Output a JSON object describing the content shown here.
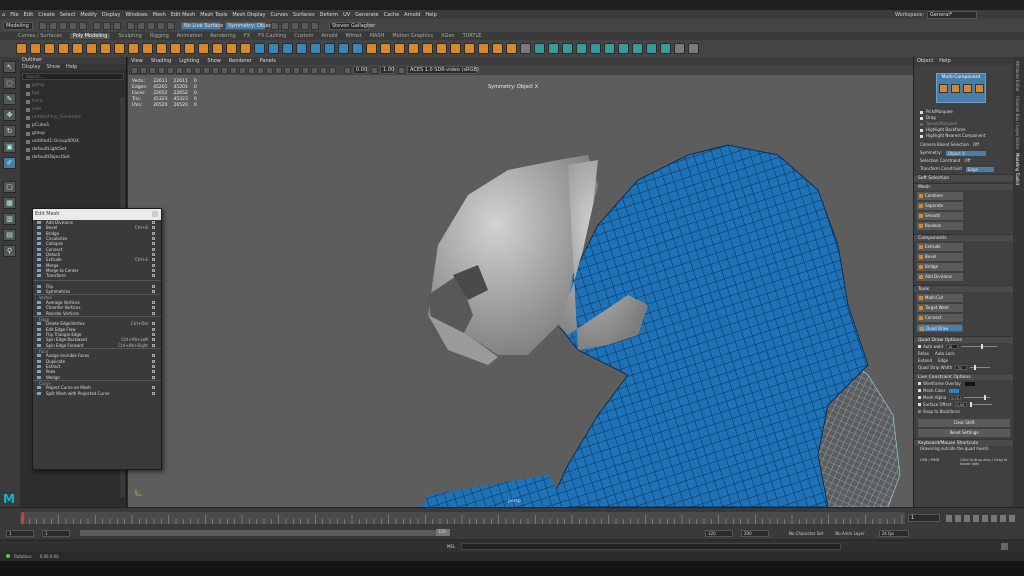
{
  "menubar": {
    "items": [
      "File",
      "Edit",
      "Create",
      "Select",
      "Modify",
      "Display",
      "Windows",
      "Mesh",
      "Edit Mesh",
      "Mesh Tools",
      "Mesh Display",
      "Curves",
      "Surfaces",
      "Deform",
      "UV",
      "Generate",
      "Cache",
      "Arnold",
      "Help"
    ],
    "workspace_label": "Workspace:",
    "workspace_value": "General*"
  },
  "shelfbar": {
    "mode": "Modeling",
    "no_live": "No Live Surface",
    "symmetry": "Symmetry: Object X",
    "user": "Steven Gallagher"
  },
  "shelf_tabs": [
    "Curves / Surfaces",
    "Poly Modeling",
    "Sculpting",
    "Rigging",
    "Animation",
    "Rendering",
    "FX",
    "FX Caching",
    "Custom",
    "Arnold",
    "Bifrost",
    "MASH",
    "Motion Graphics",
    "XGen",
    "TURTLE"
  ],
  "shelf_active": "Poly Modeling",
  "outliner": {
    "title": "Outliner",
    "menu": [
      "Display",
      "Show",
      "Help"
    ],
    "search": "Search...",
    "items": [
      {
        "label": "persp",
        "dim": true
      },
      {
        "label": "top",
        "dim": true
      },
      {
        "label": "front",
        "dim": true
      },
      {
        "label": "side",
        "dim": true
      },
      {
        "label": "untitled:Ivy_Generate",
        "dim": true
      },
      {
        "label": "pCube1",
        "dim": false
      },
      {
        "label": "group",
        "dim": false
      },
      {
        "label": "untitled1:Group0004",
        "dim": false
      },
      {
        "label": "defaultLightSet",
        "dim": false
      },
      {
        "label": "defaultObjectSet",
        "dim": false
      }
    ]
  },
  "viewport": {
    "menu": [
      "View",
      "Shading",
      "Lighting",
      "Show",
      "Renderer",
      "Panels"
    ],
    "gamma": "0.00",
    "exposure": "1.00",
    "colorspace": "ACES 1.0 SDR-video (sRGB)",
    "symmetry": "Symmetry: Object X",
    "camera": "persp",
    "hud": [
      {
        "k": "Verts:",
        "a": "22611",
        "b": "22611",
        "c": "0"
      },
      {
        "k": "Edges:",
        "a": "45201",
        "b": "45201",
        "c": "0"
      },
      {
        "k": "Faces:",
        "a": "22652",
        "b": "22652",
        "c": "0"
      },
      {
        "k": "Tris:",
        "a": "45323",
        "b": "45323",
        "c": "0"
      },
      {
        "k": "UVs:",
        "a": "26520",
        "b": "26520",
        "c": "0"
      }
    ]
  },
  "edit_mesh": {
    "title": "Edit Mesh",
    "groups": [
      {
        "section": "",
        "items": [
          {
            "l": "Add Divisions",
            "s": ""
          },
          {
            "l": "Bevel",
            "s": "Ctrl+B"
          },
          {
            "l": "Bridge",
            "s": ""
          },
          {
            "l": "Circularize",
            "s": ""
          },
          {
            "l": "Collapse",
            "s": ""
          },
          {
            "l": "Connect",
            "s": ""
          },
          {
            "l": "Detach",
            "s": ""
          },
          {
            "l": "Extrude",
            "s": "Ctrl+E"
          },
          {
            "l": "Merge",
            "s": ""
          },
          {
            "l": "Merge to Center",
            "s": ""
          },
          {
            "l": "Transform",
            "s": ""
          }
        ]
      },
      {
        "section": "",
        "items": [
          {
            "l": "Flip",
            "s": ""
          },
          {
            "l": "Symmetrize",
            "s": ""
          }
        ]
      },
      {
        "section": "Vertex",
        "items": [
          {
            "l": "Average Vertices",
            "s": ""
          },
          {
            "l": "Chamfer Vertices",
            "s": ""
          },
          {
            "l": "Reorder Vertices",
            "s": ""
          }
        ]
      },
      {
        "section": "Edge",
        "items": [
          {
            "l": "Delete Edge/Vertex",
            "s": "Ctrl+Del"
          },
          {
            "l": "Edit Edge Flow",
            "s": ""
          },
          {
            "l": "Flip Triangle Edge",
            "s": ""
          },
          {
            "l": "Spin Edge Backward",
            "s": "Ctrl+Alt+Left"
          },
          {
            "l": "Spin Edge Forward",
            "s": "Ctrl+Alt+Right"
          }
        ]
      },
      {
        "section": "Face",
        "items": [
          {
            "l": "Assign Invisible Faces",
            "s": ""
          },
          {
            "l": "Duplicate",
            "s": ""
          },
          {
            "l": "Extract",
            "s": ""
          },
          {
            "l": "Poke",
            "s": ""
          },
          {
            "l": "Wedge",
            "s": ""
          }
        ]
      },
      {
        "section": "Curve",
        "items": [
          {
            "l": "Project Curve on Mesh",
            "s": ""
          },
          {
            "l": "Split Mesh with Projected Curve",
            "s": ""
          }
        ]
      }
    ]
  },
  "right_panel": {
    "menu": [
      "Object",
      "Help"
    ],
    "multi_component": "Multi-Component",
    "pick_marquee": "Pick/Marquee",
    "drag": "Drag",
    "tweak_marquee": "Tweak/Marquee",
    "highlight_backfaces": "Highlight Backfaces",
    "highlight_nearest": "Highlight Nearest Component",
    "camera_based_selection": "Camera Based Selection",
    "camera_based_value": "Off",
    "symmetry_label": "Symmetry:",
    "symmetry_value": "Object X",
    "selection_constraint": "Selection Constraint",
    "selection_constraint_value": "Off",
    "transform_constraint": "Transform Constraint",
    "transform_constraint_value": "Edge",
    "soft_selection": "Soft Selection",
    "sections": {
      "mesh": "Mesh",
      "components": "Components",
      "tools": "Tools",
      "quad_draw": "Quad Draw Options",
      "live": "Live Constraint Options",
      "keyboard": "Keyboard/Mouse Shortcuts"
    },
    "mesh_btns": [
      "Combine",
      "Separate",
      "Smooth",
      "Boolean"
    ],
    "comp_btns": [
      "Extrude",
      "Bevel",
      "Bridge",
      "Add Divisions"
    ],
    "tool_btns": [
      "Multi-Cut",
      "Target Weld",
      "Connect",
      "Quad Draw"
    ],
    "auto_weld": "Auto weld",
    "auto_weld_value": "10",
    "relax": "Relax",
    "relax_value": "Auto Lock",
    "extend": "Extend",
    "extend_value": "Edge",
    "quad_strip": "Quad Strip Width",
    "quad_strip_value": "70",
    "wireframe_overlay": "Wireframe Overlay",
    "mesh_color": "Mesh Color",
    "mesh_alpha": "Mesh Alpha",
    "mesh_alpha_value": "0.75",
    "surface_offset": "Surface Offset",
    "surface_offset_value": "0.00",
    "snap_backfaces": "Snap to Backfaces",
    "clear_shift": "Clear Shift",
    "reset_settings": "Reset Settings",
    "shortcut_note": "(Hovering outside the quad mesh)",
    "lmb_label": "LMB / MMB",
    "lmb_desc": "Click to drop dots / Drag to tweak dots",
    "mesh_color_hex": "#1e88d0"
  },
  "side_tabs": [
    "Attribute Editor",
    "Channel Box / Layer Editor",
    "Modeling Toolkit"
  ],
  "timeline": {
    "current_frame": "1",
    "range_start": "1",
    "range_start2": "1",
    "range_current": "120",
    "range_end": "120",
    "range_end2": "200",
    "char_set": "No Character Set",
    "anim_layer": "No Anim Layer",
    "fps": "24 fps",
    "status_label": "Rotation:",
    "status_values": "0.00    0.00",
    "mel": "MEL"
  }
}
